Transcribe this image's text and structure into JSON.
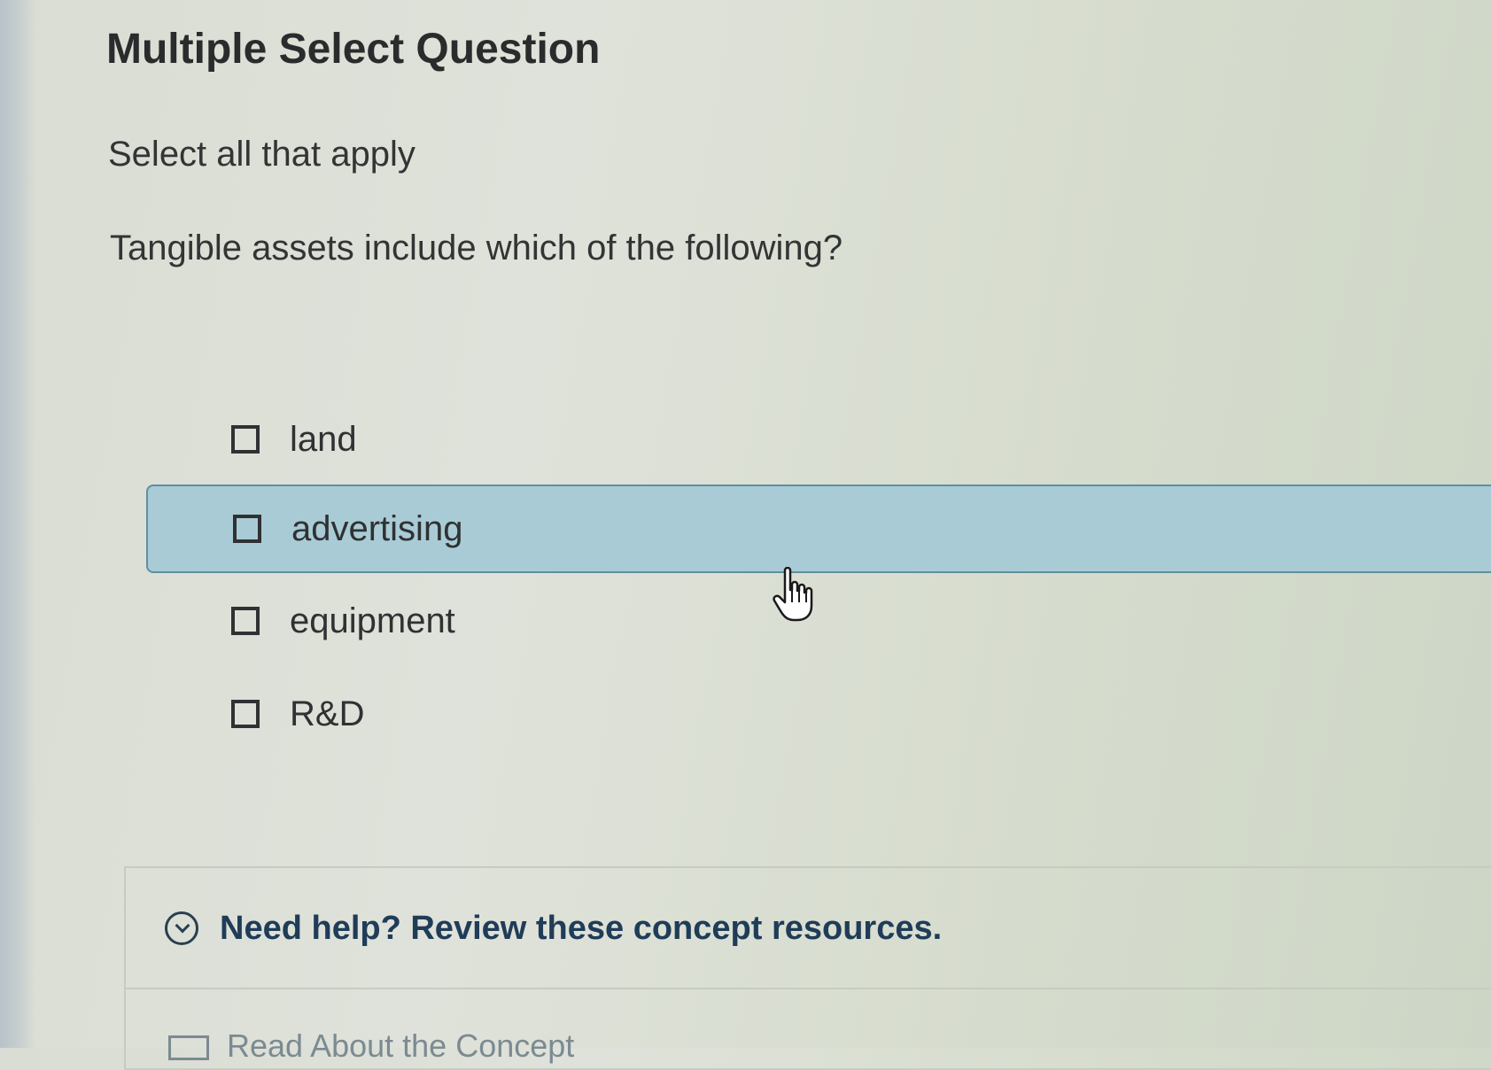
{
  "question": {
    "title": "Multiple Select Question",
    "instruction": "Select all that apply",
    "prompt": "Tangible assets include which of the following?"
  },
  "options": [
    {
      "label": "land",
      "checked": false,
      "hovered": false
    },
    {
      "label": "advertising",
      "checked": false,
      "hovered": true
    },
    {
      "label": "equipment",
      "checked": false,
      "hovered": false
    },
    {
      "label": "R&D",
      "checked": false,
      "hovered": false
    }
  ],
  "help": {
    "toggle_label": "Need help? Review these concept resources.",
    "toggle_icon": "chevron-down-circle-icon",
    "first_resource_label": "Read About the Concept",
    "first_resource_icon": "book-icon"
  },
  "colors": {
    "hover_background": "#a9cbd5",
    "hover_border": "#5f8fa0",
    "help_link": "#1f3c58"
  },
  "cursor": {
    "type": "hand-pointer"
  }
}
